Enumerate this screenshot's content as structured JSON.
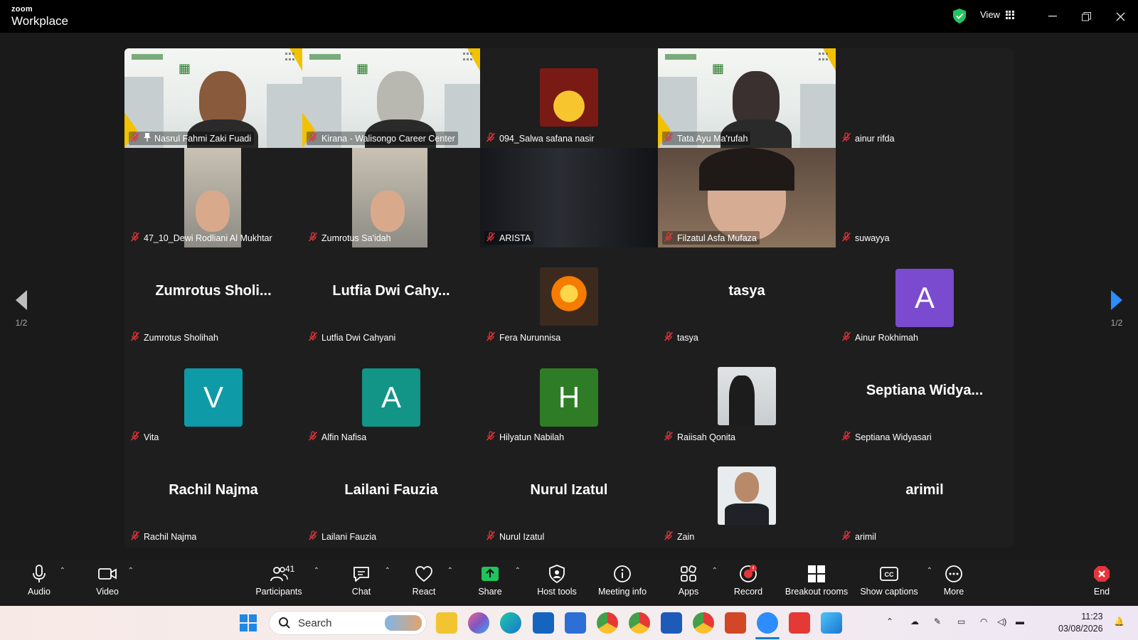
{
  "window": {
    "brand_top": "zoom",
    "brand_bottom": "Workplace",
    "view_label": "View"
  },
  "pager": {
    "left": "1/2",
    "right": "1/2"
  },
  "tiles": [
    {
      "name": "Nasrul Fahmi Zaki Fuadi",
      "kind": "banner-face",
      "pinned": true
    },
    {
      "name": "Kirana - Walisongo Career Center",
      "kind": "banner",
      "active": true
    },
    {
      "name": "094_Salwa safana nasir",
      "kind": "emoji-photo"
    },
    {
      "name": "Tata Ayu Ma'rufah",
      "kind": "banner-face"
    },
    {
      "name": "ainur rifda",
      "kind": "blank"
    },
    {
      "name": "47_10_Dewi Rodliani Al Mukhtar",
      "kind": "portrait-photo"
    },
    {
      "name": "Zumrotus Sa'idah",
      "kind": "portrait-photo"
    },
    {
      "name": "ARISTA",
      "kind": "dark-video"
    },
    {
      "name": "Filzatul Asfa Mufaza",
      "kind": "face-video"
    },
    {
      "name": "suwayya",
      "kind": "blank"
    },
    {
      "name": "Zumrotus Sholihah",
      "kind": "text",
      "big": "Zumrotus  Sholi..."
    },
    {
      "name": "Lutfia Dwi Cahyani",
      "kind": "text",
      "big": "Lutfia Dwi Cahy..."
    },
    {
      "name": "Fera Nurunnisa",
      "kind": "fire-photo"
    },
    {
      "name": "tasya",
      "kind": "text",
      "big": "tasya"
    },
    {
      "name": "Ainur Rokhimah",
      "kind": "letter",
      "letter": "A",
      "color": "#7a4bcf"
    },
    {
      "name": "Vita",
      "kind": "letter",
      "letter": "V",
      "color": "#0f9aa8"
    },
    {
      "name": "Alfin Nafisa",
      "kind": "letter",
      "letter": "A",
      "color": "#129487"
    },
    {
      "name": "Hilyatun Nabilah",
      "kind": "letter",
      "letter": "H",
      "color": "#2e7d26"
    },
    {
      "name": "Raiisah Qonita",
      "kind": "selfie-photo"
    },
    {
      "name": "Septiana Widyasari",
      "kind": "text",
      "big": "Septiana  Widya..."
    },
    {
      "name": "Rachil Najma",
      "kind": "text",
      "big": "Rachil Najma"
    },
    {
      "name": "Lailani Fauzia",
      "kind": "text",
      "big": "Lailani Fauzia"
    },
    {
      "name": "Nurul Izatul",
      "kind": "text",
      "big": "Nurul Izatul"
    },
    {
      "name": "Zain",
      "kind": "formal-photo"
    },
    {
      "name": "arimil",
      "kind": "text",
      "big": "arimil"
    }
  ],
  "toolbar": {
    "audio": "Audio",
    "video": "Video",
    "participants": "Participants",
    "participants_count": "41",
    "chat": "Chat",
    "react": "React",
    "share": "Share",
    "host_tools": "Host tools",
    "meeting_info": "Meeting info",
    "apps": "Apps",
    "record": "Record",
    "breakout": "Breakout rooms",
    "captions": "Show captions",
    "more": "More",
    "end": "End"
  },
  "taskbar": {
    "search_placeholder": "Search",
    "time": "11:23",
    "date": "03/08/2026"
  },
  "colors": {
    "active_speaker": "#2bdc71",
    "share_green": "#1fc45d",
    "end_red": "#e5343a",
    "shield_green": "#22c55e"
  }
}
